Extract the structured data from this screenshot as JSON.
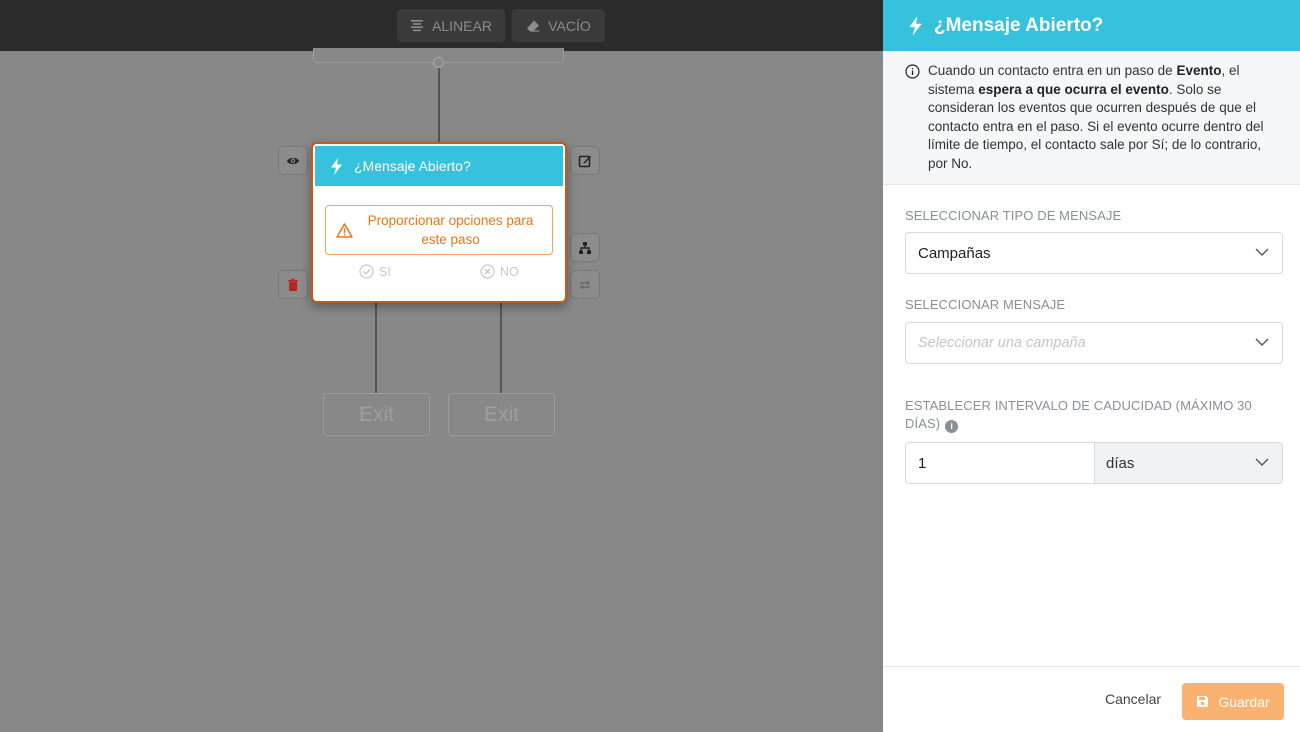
{
  "toolbar": {
    "align_label": "ALINEAR",
    "empty_label": "VACÍO"
  },
  "node": {
    "title": "¿Mensaje Abierto?",
    "warning": "Proporcionar opciones para este paso",
    "yes_label": "SI",
    "no_label": "NO"
  },
  "exits": [
    "Exit",
    "Exit"
  ],
  "panel": {
    "title": "¿Mensaje Abierto?",
    "info": {
      "p1": "Cuando un contacto entra en un paso de ",
      "b1": "Evento",
      "p2": ", el sistema ",
      "b2": "espera a que ocurra el evento",
      "p3": ". Solo se consideran los eventos que ocurren después de que el contacto entra en el paso. Si el evento ocurre dentro del límite de tiempo, el contacto sale por Sí; de lo contrario, por No."
    },
    "message_type_label": "SELECCIONAR TIPO DE MENSAJE",
    "message_type_value": "Campañas",
    "message_label": "SELECCIONAR MENSAJE",
    "message_placeholder": "Seleccionar una campaña",
    "expiry_label": "ESTABLECER INTERVALO DE CADUCIDAD (MÁXIMO 30 DÍAS)",
    "expiry_value": "1",
    "expiry_unit": "días",
    "cancel_label": "Cancelar",
    "save_label": "Guardar"
  },
  "colors": {
    "accent": "#36c1dc",
    "warning": "#e8761a",
    "node_border": "#c25b14",
    "save": "#f9b26f"
  }
}
